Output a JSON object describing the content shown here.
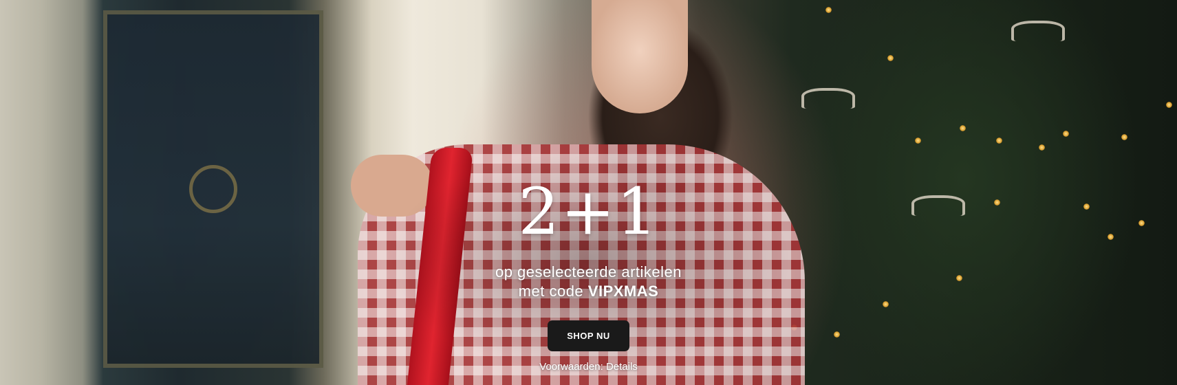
{
  "banner": {
    "headline": "2+1",
    "subline_part1": "op geselecteerde artikelen",
    "subline_part2": "met code",
    "promo_code": "VIPXMAS",
    "cta_label": "SHOP NU",
    "terms_label": "Voorwaarden:",
    "terms_link": "Details"
  },
  "colors": {
    "text": "#ffffff",
    "button_bg": "#1a1a1a",
    "ribbon": "#d41f2b",
    "shirt_red": "#a83638"
  },
  "icons": []
}
